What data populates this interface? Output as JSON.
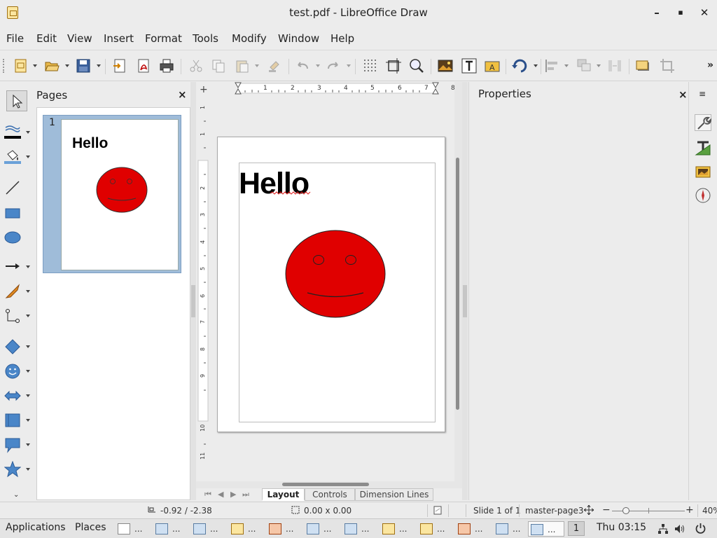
{
  "window": {
    "title": "test.pdf - LibreOffice Draw",
    "minimize": "–",
    "maximize": "▪",
    "close": "✕"
  },
  "menu": [
    "File",
    "Edit",
    "View",
    "Insert",
    "Format",
    "Tools",
    "Modify",
    "Window",
    "Help"
  ],
  "toolbar": {
    "icons": [
      "new-icon",
      "open-icon",
      "save-icon",
      "export-icon",
      "export-pdf-icon",
      "print-icon",
      "cut-icon",
      "copy-icon",
      "paste-icon",
      "clone-formatting-icon",
      "undo-icon",
      "redo-icon",
      "grid-icon",
      "helplines-icon",
      "zoom-icon",
      "image-icon",
      "textbox-icon",
      "fontwork-icon",
      "rotate-icon",
      "align-icon",
      "arrange-icon",
      "distribute-icon",
      "shadow-icon",
      "crop-icon"
    ],
    "overflow": "»"
  },
  "pages_panel": {
    "title": "Pages",
    "close": "×",
    "pages": [
      {
        "number": "1",
        "text": "Hello"
      }
    ]
  },
  "document": {
    "text": "Hello",
    "shape": "smiley-face",
    "shape_color": "#e00000",
    "ruler_corner": "+",
    "hruler_labels": [
      "1",
      "2",
      "3",
      "4",
      "5",
      "6",
      "7",
      "8"
    ],
    "vruler_labels": [
      "1",
      "1",
      "2",
      "3",
      "4",
      "5",
      "6",
      "7",
      "8",
      "9",
      "10",
      "11"
    ]
  },
  "layer_tabs": [
    "Layout",
    "Controls",
    "Dimension Lines"
  ],
  "active_layer": "Layout",
  "properties_panel": {
    "title": "Properties",
    "close": "×",
    "deck_icons": [
      "properties-icon",
      "styles-icon",
      "gallery-icon",
      "navigator-icon"
    ]
  },
  "statusbar": {
    "position": "-0.92 / -2.38",
    "size": "0.00 x 0.00",
    "slide": "Slide 1 of 1",
    "master": "master-page3",
    "zoom_minus": "−",
    "zoom_plus": "+",
    "zoom": "40%"
  },
  "taskbar": {
    "applications": "Applications",
    "places": "Places",
    "task_ellipsis": "...",
    "workspace": "1",
    "clock": "Thu 03:15"
  }
}
